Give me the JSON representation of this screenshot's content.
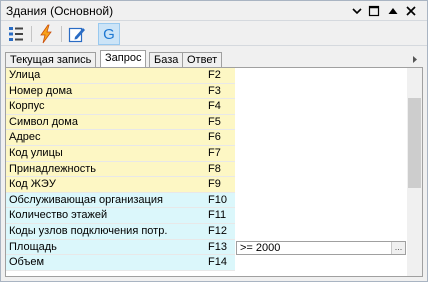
{
  "window": {
    "title": "Здания (Основной)"
  },
  "title_controls": [
    "chevron-down-icon",
    "restore-icon",
    "up-triangle-icon",
    "close-icon"
  ],
  "toolbar": {
    "buttons": [
      {
        "icon": "fields-list-icon",
        "active": false
      },
      {
        "icon": "lightning-icon",
        "active": false
      },
      {
        "icon": "edit-icon",
        "active": false
      },
      {
        "icon": "g-letter-icon",
        "label": "G",
        "active": true
      }
    ]
  },
  "tabs": [
    {
      "label": "Текущая запись",
      "active": false
    },
    {
      "label": "Запрос",
      "active": true
    },
    {
      "label": "База",
      "active": false
    },
    {
      "label": "Ответ",
      "active": false
    }
  ],
  "grid": {
    "rows": [
      {
        "name": "Улица",
        "field": "F2",
        "color": "yellow",
        "value": ""
      },
      {
        "name": "Номер дома",
        "field": "F3",
        "color": "yellow",
        "value": ""
      },
      {
        "name": "Корпус",
        "field": "F4",
        "color": "yellow",
        "value": ""
      },
      {
        "name": "Символ дома",
        "field": "F5",
        "color": "yellow",
        "value": ""
      },
      {
        "name": "Адрес",
        "field": "F6",
        "color": "yellow",
        "value": ""
      },
      {
        "name": "Код улицы",
        "field": "F7",
        "color": "yellow",
        "value": ""
      },
      {
        "name": "Принадлежность",
        "field": "F8",
        "color": "yellow",
        "value": ""
      },
      {
        "name": "Код ЖЭУ",
        "field": "F9",
        "color": "yellow",
        "value": ""
      },
      {
        "name": "Обслуживающая организация",
        "field": "F10",
        "color": "cyan",
        "value": ""
      },
      {
        "name": "Количество этажей",
        "field": "F11",
        "color": "cyan",
        "value": ""
      },
      {
        "name": "Коды узлов подключения потр.",
        "field": "F12",
        "color": "cyan",
        "value": ""
      },
      {
        "name": "Площадь",
        "field": "F13",
        "color": "cyan",
        "value": ">= 2000",
        "editing": true,
        "ellipsis": "..."
      },
      {
        "name": "Объем",
        "field": "F14",
        "color": "cyan",
        "value": ""
      }
    ]
  },
  "colors": {
    "yellow": "#fdf7c4",
    "cyan": "#dbf7fb",
    "active_tool": "#cce4f7"
  }
}
